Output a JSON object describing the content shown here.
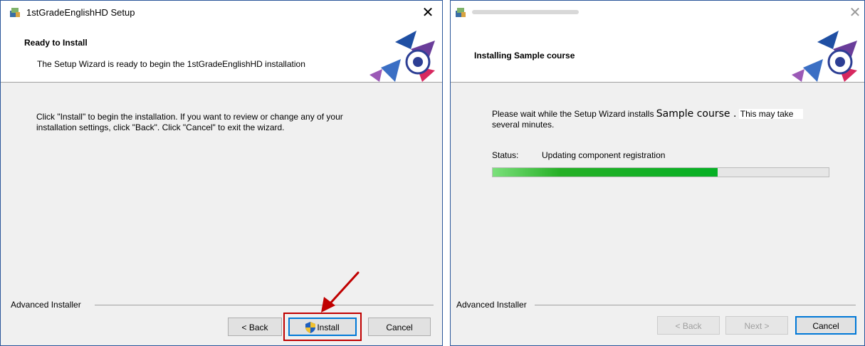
{
  "left_window": {
    "title": "1stGradeEnglishHD Setup",
    "heading": "Ready to Install",
    "subheading": "The Setup Wizard is ready to begin the 1stGradeEnglishHD installation",
    "body_line1": "Click \"Install\" to begin the installation.  If you want to review or change any of your",
    "body_line2": "installation settings, click \"Back\".  Click \"Cancel\" to exit the wizard.",
    "footer_label": "Advanced Installer",
    "buttons": {
      "back": "< Back",
      "install": "Install",
      "cancel": "Cancel"
    },
    "close_glyph": "✕"
  },
  "right_window": {
    "heading": "Installing Sample course",
    "wait_text_before": "Please wait while the Setup Wizard installs",
    "wait_product": "Sample course .",
    "wait_text_after": "This may take",
    "wait_line2": "several minutes.",
    "status_label": "Status:",
    "status_value": "Updating component registration",
    "progress_fraction": 0.67,
    "footer_label": "Advanced Installer",
    "buttons": {
      "back": "< Back",
      "next": "Next >",
      "cancel": "Cancel"
    },
    "close_glyph": "✕"
  },
  "icons": {
    "app": "installer-icon",
    "shield": "uac-shield-icon",
    "close": "close-icon",
    "arrow": "red-arrow-annotation"
  },
  "colors": {
    "accent": "#0078d7",
    "annotation": "#c00000",
    "progress": "#06b025"
  }
}
